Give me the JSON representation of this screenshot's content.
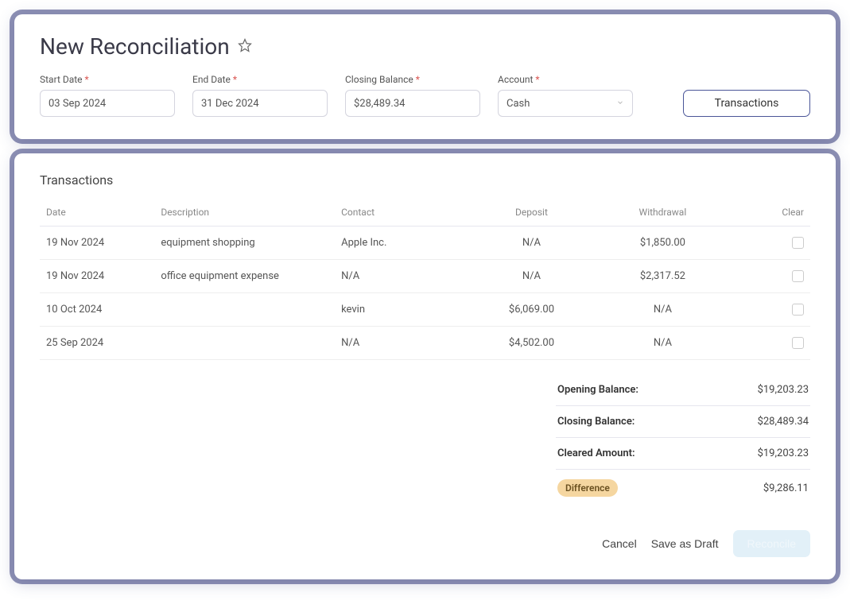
{
  "header": {
    "title": "New Reconciliation"
  },
  "filters": {
    "start_date": {
      "label": "Start Date",
      "value": "03 Sep 2024"
    },
    "end_date": {
      "label": "End Date",
      "value": "31 Dec 2024"
    },
    "closing_balance": {
      "label": "Closing Balance",
      "value": "$28,489.34"
    },
    "account": {
      "label": "Account",
      "value": "Cash"
    },
    "transactions_button": "Transactions"
  },
  "transactions": {
    "title": "Transactions",
    "columns": {
      "date": "Date",
      "description": "Description",
      "contact": "Contact",
      "deposit": "Deposit",
      "withdrawal": "Withdrawal",
      "clear": "Clear"
    },
    "rows": [
      {
        "date": "19 Nov 2024",
        "description": "equipment shopping",
        "contact": "Apple Inc.",
        "deposit": "N/A",
        "withdrawal": "$1,850.00",
        "clear": false
      },
      {
        "date": "19 Nov 2024",
        "description": "office equipment expense",
        "contact": "N/A",
        "deposit": "N/A",
        "withdrawal": "$2,317.52",
        "clear": false
      },
      {
        "date": "10 Oct 2024",
        "description": "",
        "contact": "kevin",
        "deposit": "$6,069.00",
        "withdrawal": "N/A",
        "clear": false
      },
      {
        "date": "25 Sep 2024",
        "description": "",
        "contact": "N/A",
        "deposit": "$4,502.00",
        "withdrawal": "N/A",
        "clear": false
      }
    ]
  },
  "summary": {
    "opening_balance": {
      "label": "Opening Balance:",
      "value": "$19,203.23"
    },
    "closing_balance": {
      "label": "Closing Balance:",
      "value": "$28,489.34"
    },
    "cleared_amount": {
      "label": "Cleared Amount:",
      "value": "$19,203.23"
    },
    "difference": {
      "label": "Difference",
      "value": "$9,286.11"
    }
  },
  "actions": {
    "cancel": "Cancel",
    "save_draft": "Save as Draft",
    "reconcile": "Reconcile"
  }
}
